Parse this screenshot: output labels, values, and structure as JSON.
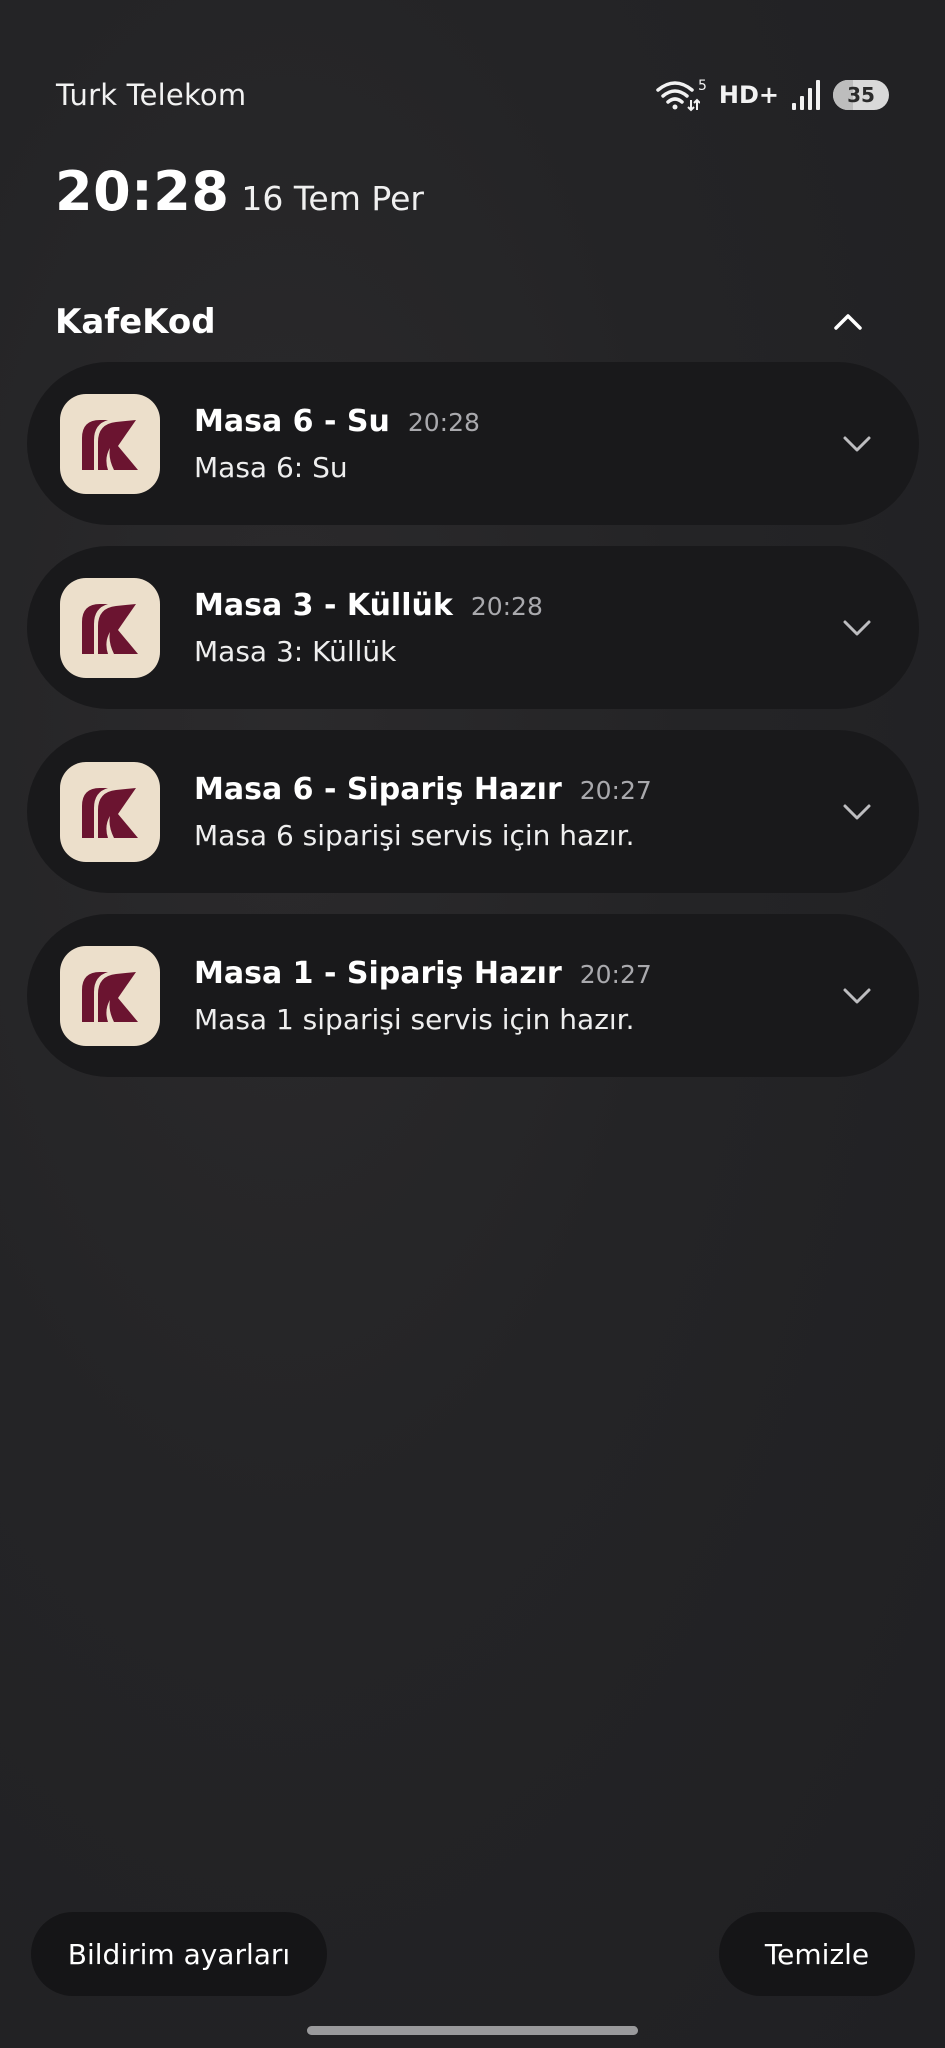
{
  "status_bar": {
    "carrier": "Turk Telekom",
    "wifi_badge": "5",
    "network_type": "HD+",
    "battery_level": "35",
    "battery_fraction": 0.35
  },
  "lockscreen": {
    "time": "20:28",
    "date": "16 Tem Per"
  },
  "notification_group": {
    "app_name": "KafeKod",
    "accent_color": "#6b1430",
    "icon_background": "#ecdfcb",
    "notifications": [
      {
        "title": "Masa 6 - Su",
        "time": "20:28",
        "body": "Masa 6: Su"
      },
      {
        "title": "Masa 3 - Küllük",
        "time": "20:28",
        "body": "Masa 3: Küllük"
      },
      {
        "title": "Masa 6 - Sipariş Hazır",
        "time": "20:27",
        "body": "Masa 6 siparişi servis için hazır."
      },
      {
        "title": "Masa 1 - Sipariş Hazır",
        "time": "20:27",
        "body": "Masa 1 siparişi servis için hazır."
      }
    ]
  },
  "actions": {
    "settings_label": "Bildirim ayarları",
    "clear_label": "Temizle"
  },
  "icons": {
    "collapse": "chevron-up-icon",
    "expand": "chevron-down-icon",
    "wifi": "wifi-icon",
    "signal": "signal-icon",
    "app": "kafekod-app-icon"
  }
}
